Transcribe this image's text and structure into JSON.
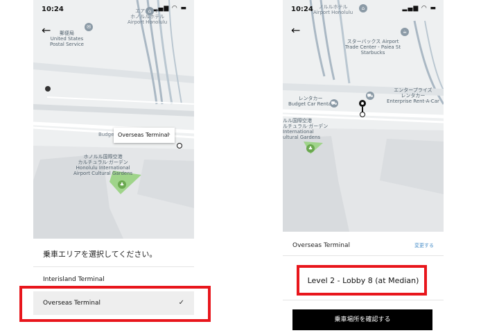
{
  "left_screen": {
    "status": {
      "time": "10:24",
      "icons": "▂▄▆ ◠ ▬"
    },
    "map_labels": {
      "post_office_jp": "郵便局",
      "post_office_en_1": "United States",
      "post_office_en_2": "Postal Service",
      "hotel_jp_1": "エアポート",
      "hotel_jp_2": "ホノルルホテル",
      "hotel_en": "Airport Honolulu",
      "budget": "Budget C",
      "garden_jp_1": "ホノルル国際空港",
      "garden_jp_2": "カルチュラル·ガーデン",
      "garden_en_1": "Honolulu International",
      "garden_en_2": "Airport Cultural Gardens"
    },
    "tooltip_label": "Overseas Terminal",
    "sheet_title": "乗車エリアを選択してください。",
    "options": [
      {
        "label": "Interisland Terminal",
        "selected": false
      },
      {
        "label": "Overseas Terminal",
        "selected": true
      }
    ],
    "highlight_color": "#e8161c"
  },
  "right_screen": {
    "status": {
      "time": "10:24",
      "icons": "▂▄▆ ◠ ▬"
    },
    "map_labels": {
      "hotel_jp": "ノルルホテル",
      "hotel_en": "Airport Honolulu",
      "starbucks_jp": "スターバックス Airport",
      "starbucks_en_1": "Trade Center - Paiea St",
      "starbucks_en_2": "Starbucks",
      "rental_jp": "レンタカー",
      "rental_en": "Budget Car Rental",
      "enterprise_jp_1": "エンタープライズ",
      "enterprise_jp_2": "レンタカー",
      "enterprise_en": "Enterprise Rent-A-Car",
      "garden_jp_1": "ルル国際空港",
      "garden_jp_2": "ルチュラル·ガーデン",
      "garden_en_1": "International",
      "garden_en_2": "ultural Gardens"
    },
    "terminal": "Overseas Terminal",
    "change_link": "変更する",
    "pickup_spot": "Level 2 - Lobby 8 (at Median)",
    "confirm_button": "乗車場所を確認する",
    "highlight_color": "#e8161c"
  },
  "icons": [
    "back-arrow-icon",
    "location-dot-icon",
    "chevron-right-icon",
    "checkmark-icon",
    "pin-icon",
    "park-icon",
    "post-icon",
    "hotel-icon",
    "coffee-icon",
    "car-icon"
  ]
}
